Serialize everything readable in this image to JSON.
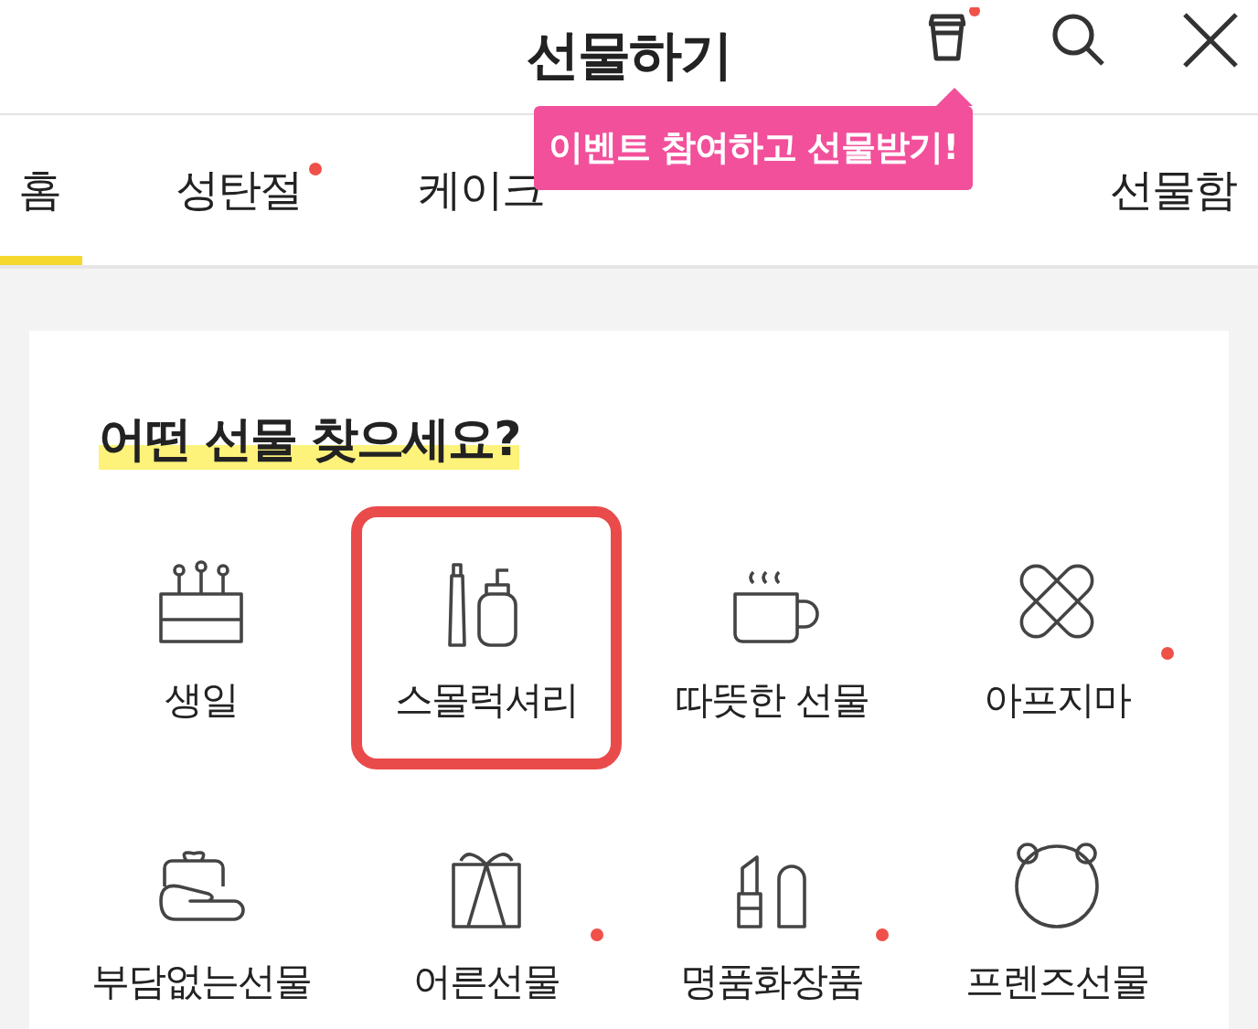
{
  "header": {
    "title": "선물하기",
    "cup_dot": true
  },
  "tooltip": {
    "text": "이벤트 참여하고 선물받기!"
  },
  "tabs": [
    {
      "label": "홈",
      "selected": true,
      "dot": false
    },
    {
      "label": "성탄절",
      "selected": false,
      "dot": true
    },
    {
      "label": "케이크",
      "selected": false,
      "dot": false
    },
    {
      "selected": false
    },
    {
      "selected": false
    },
    {
      "label": "선물함",
      "selected": false,
      "dot": false
    }
  ],
  "section": {
    "heading": "어떤 선물 찾으세요?"
  },
  "categories": [
    {
      "label": "생일",
      "highlighted": false,
      "dot": false
    },
    {
      "label": "스몰럭셔리",
      "highlighted": true,
      "dot": false
    },
    {
      "label": "따뜻한 선물",
      "highlighted": false,
      "dot": false
    },
    {
      "label": "아프지마",
      "highlighted": false,
      "dot": true
    },
    {
      "label": "부담없는선물",
      "highlighted": false,
      "dot": false
    },
    {
      "label": "어른선물",
      "highlighted": false,
      "dot": true
    },
    {
      "label": "명품화장품",
      "highlighted": false,
      "dot": true
    },
    {
      "label": "프렌즈선물",
      "highlighted": false,
      "dot": false
    }
  ]
}
